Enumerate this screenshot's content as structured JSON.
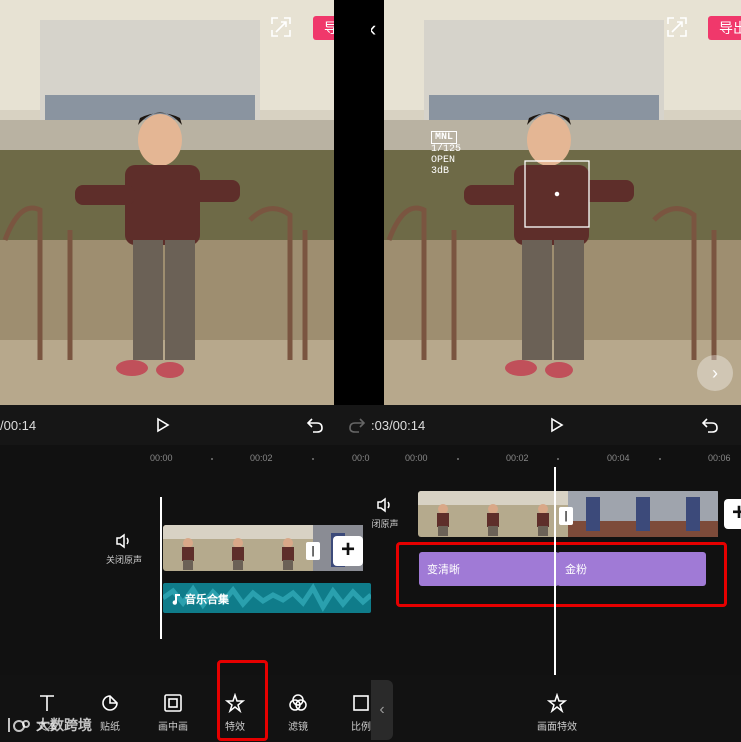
{
  "left": {
    "export_label": "导出",
    "time_readout": "/00:14",
    "ruler": [
      "00:00",
      "00:02",
      "00:0"
    ],
    "mute_label": "关闭原声",
    "audio_label": "音乐合集",
    "tools": [
      {
        "label": "文本",
        "icon": "text-icon"
      },
      {
        "label": "贴纸",
        "icon": "sticker-icon"
      },
      {
        "label": "画中画",
        "icon": "picture-in-picture-icon"
      },
      {
        "label": "特效",
        "icon": "effects-icon"
      },
      {
        "label": "滤镜",
        "icon": "filter-icon"
      },
      {
        "label": "比例",
        "icon": "ratio-icon"
      }
    ]
  },
  "right": {
    "export_label": "导出",
    "camera_info": {
      "mode": "MNL",
      "shutter": "1/125",
      "aperture": "OPEN",
      "gain": "3dB"
    },
    "time_readout": ":03/00:14",
    "ruler": [
      "00:00",
      "00:02",
      "00:04",
      "00:06"
    ],
    "mute_label": "闭原声",
    "effects": [
      {
        "label": "变清晰",
        "color": "#a07ad6"
      },
      {
        "label": "金粉",
        "color": "#a07ad6"
      }
    ],
    "tool": {
      "label": "画面特效",
      "icon": "effects-icon"
    }
  },
  "watermark": "大数跨境",
  "colors": {
    "accent": "#f0386b",
    "audio": "#0f7c8a",
    "effect": "#a07ad6",
    "highlight": "#e60000"
  }
}
